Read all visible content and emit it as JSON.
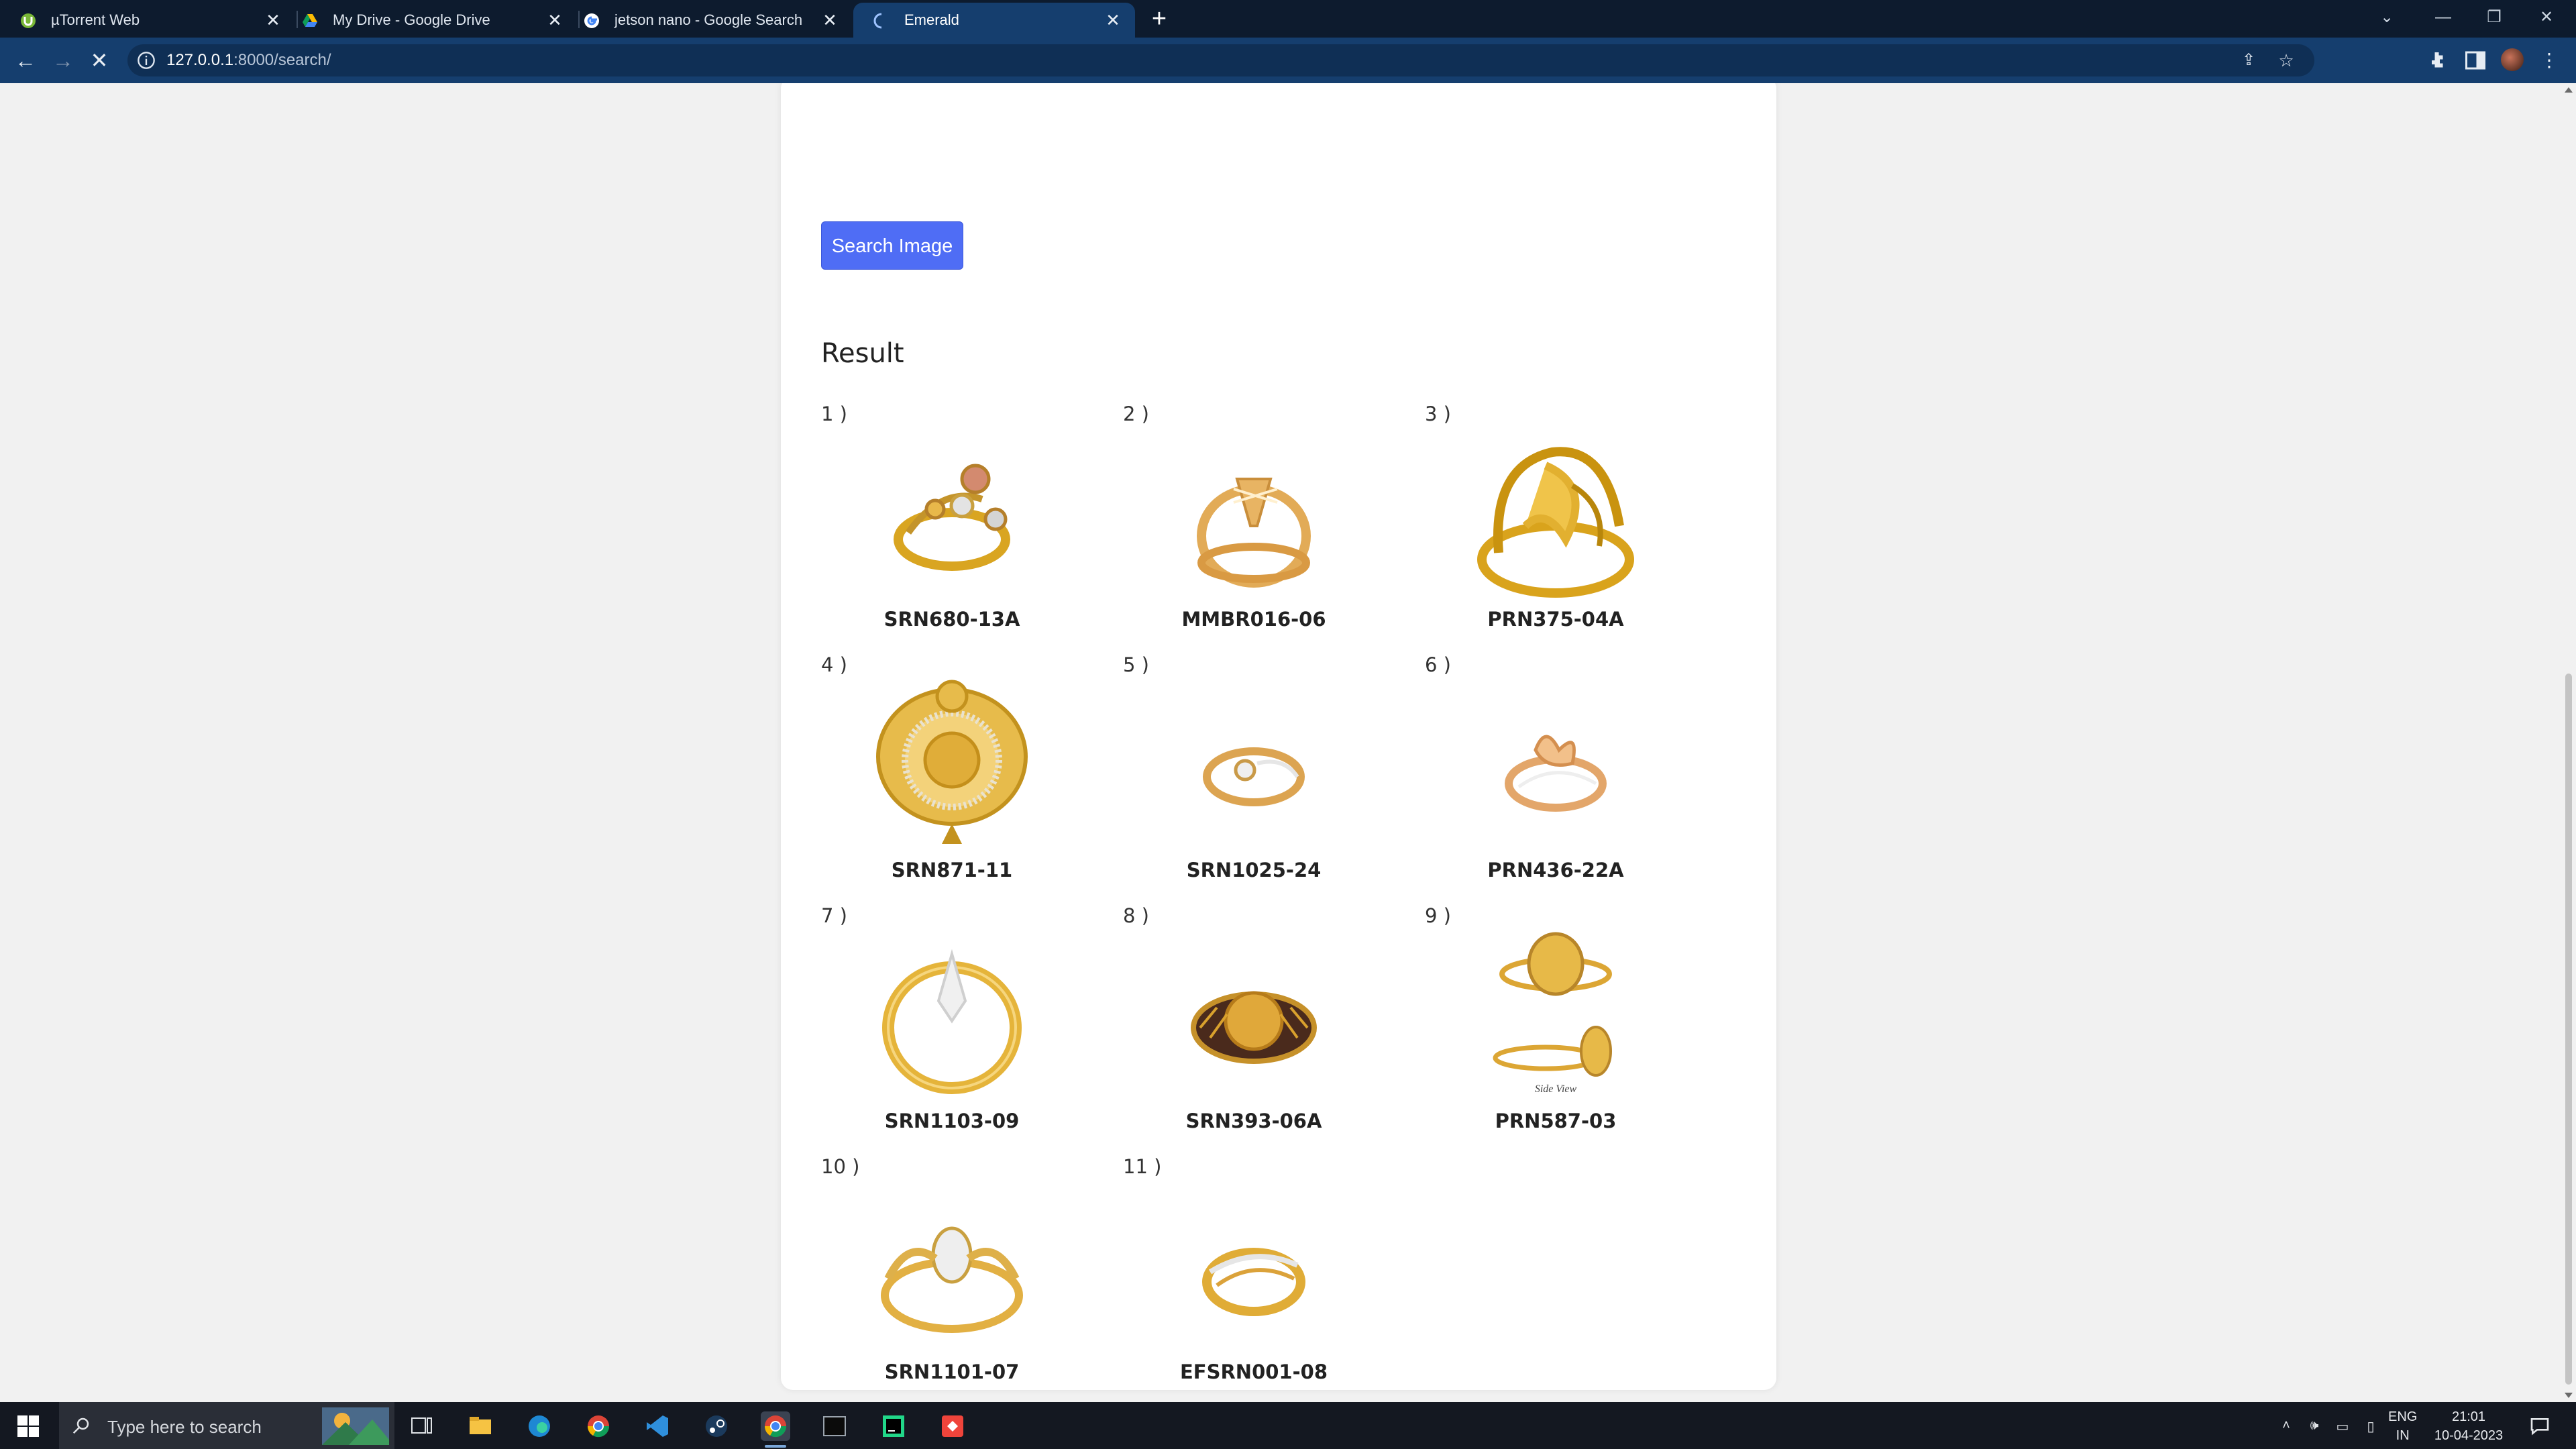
{
  "browser": {
    "tabs": [
      {
        "title": "µTorrent Web",
        "icon": "utorrent-icon",
        "active": false
      },
      {
        "title": "My Drive - Google Drive",
        "icon": "google-drive-icon",
        "active": false
      },
      {
        "title": "jetson nano - Google Search",
        "icon": "google-icon",
        "active": false
      },
      {
        "title": "Emerald",
        "icon": "loading-spinner-icon",
        "active": true
      }
    ],
    "url_host": "127.0.0.1",
    "url_path": ":8000/search/"
  },
  "page": {
    "search_button_label": "Search Image",
    "result_heading": "Result",
    "results": [
      {
        "index": "1 )",
        "code": "SRN680-13A"
      },
      {
        "index": "2 )",
        "code": "MMBR016-06"
      },
      {
        "index": "3 )",
        "code": "PRN375-04A"
      },
      {
        "index": "4 )",
        "code": "SRN871-11"
      },
      {
        "index": "5 )",
        "code": "SRN1025-24"
      },
      {
        "index": "6 )",
        "code": "PRN436-22A"
      },
      {
        "index": "7 )",
        "code": "SRN1103-09"
      },
      {
        "index": "8 )",
        "code": "SRN393-06A"
      },
      {
        "index": "9 )",
        "code": "PRN587-03"
      },
      {
        "index": "10 )",
        "code": "SRN1101-07"
      },
      {
        "index": "11 )",
        "code": "EFSRN001-08"
      }
    ],
    "side_view_caption": "Side View"
  },
  "taskbar": {
    "search_placeholder": "Type here to search",
    "lang_top": "ENG",
    "lang_bottom": "IN",
    "time": "21:01",
    "date": "10-04-2023"
  },
  "colors": {
    "tabstrip": "#0d1b2e",
    "toolbar": "#153e6e",
    "button": "#4f6df5",
    "gold": "#d9a521"
  }
}
